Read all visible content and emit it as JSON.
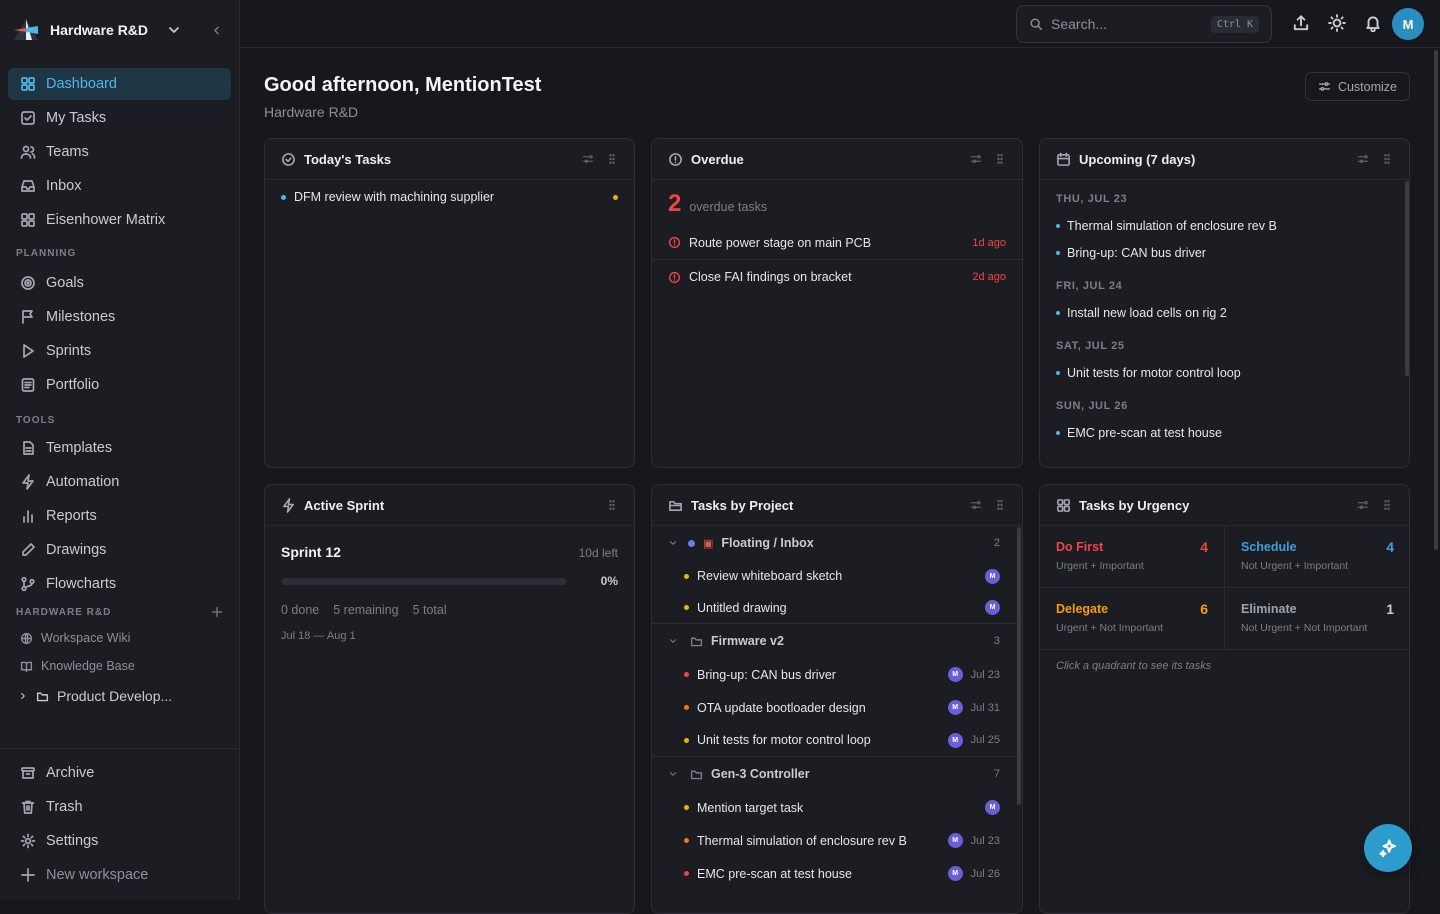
{
  "workspace": {
    "name": "Hardware R&D"
  },
  "nav": {
    "items": [
      {
        "label": "Dashboard",
        "icon": "dashboard-icon"
      },
      {
        "label": "My Tasks",
        "icon": "checkbox-icon"
      },
      {
        "label": "Teams",
        "icon": "users-icon"
      },
      {
        "label": "Inbox",
        "icon": "inbox-icon"
      },
      {
        "label": "Eisenhower Matrix",
        "icon": "grid-icon"
      }
    ]
  },
  "planning": {
    "heading": "PLANNING",
    "items": [
      {
        "label": "Goals"
      },
      {
        "label": "Milestones"
      },
      {
        "label": "Sprints"
      },
      {
        "label": "Portfolio"
      }
    ]
  },
  "tools": {
    "heading": "TOOLS",
    "items": [
      {
        "label": "Templates"
      },
      {
        "label": "Automation"
      },
      {
        "label": "Reports"
      },
      {
        "label": "Drawings"
      },
      {
        "label": "Flowcharts"
      }
    ]
  },
  "hwsection": {
    "heading": "HARDWARE R&D",
    "items": [
      {
        "label": "Workspace Wiki"
      },
      {
        "label": "Knowledge Base"
      },
      {
        "label": "Product Develop..."
      }
    ]
  },
  "bottom": {
    "items": [
      {
        "label": "Archive"
      },
      {
        "label": "Trash"
      },
      {
        "label": "Settings"
      },
      {
        "label": "New workspace"
      }
    ]
  },
  "search": {
    "placeholder": "Search...",
    "shortcut": "Ctrl K"
  },
  "user": {
    "initial": "M"
  },
  "page": {
    "greeting": "Good afternoon, MentionTest",
    "subtitle": "Hardware R&D",
    "customize": "Customize"
  },
  "today": {
    "title": "Today's Tasks",
    "tasks": [
      {
        "label": "DFM review with machining supplier"
      }
    ]
  },
  "overdue": {
    "title": "Overdue",
    "count": "2",
    "count_label": "overdue tasks",
    "tasks": [
      {
        "label": "Route power stage on main PCB",
        "ago": "1d ago"
      },
      {
        "label": "Close FAI findings on bracket",
        "ago": "2d ago"
      }
    ]
  },
  "upcoming": {
    "title": "Upcoming (7 days)",
    "groups": [
      {
        "day": "THU, JUL 23",
        "tasks": [
          "Thermal simulation of enclosure rev B",
          "Bring-up: CAN bus driver"
        ]
      },
      {
        "day": "FRI, JUL 24",
        "tasks": [
          "Install new load cells on rig 2"
        ]
      },
      {
        "day": "SAT, JUL 25",
        "tasks": [
          "Unit tests for motor control loop"
        ]
      },
      {
        "day": "SUN, JUL 26",
        "tasks": [
          "EMC pre-scan at test house"
        ]
      }
    ]
  },
  "sprint": {
    "title": "Active Sprint",
    "name": "Sprint 12",
    "left": "10d left",
    "percent": "0%",
    "progress": 0,
    "done": "0 done",
    "remaining": "5 remaining",
    "total": "5 total",
    "range": "Jul 18 — Aug 1"
  },
  "projects": {
    "title": "Tasks by Project",
    "groups": [
      {
        "name": "Floating / Inbox",
        "count": "2",
        "tasks": [
          {
            "label": "Review whiteboard sketch",
            "date": ""
          },
          {
            "label": "Untitled drawing",
            "date": ""
          }
        ]
      },
      {
        "name": "Firmware v2",
        "count": "3",
        "tasks": [
          {
            "label": "Bring-up: CAN bus driver",
            "date": "Jul 23"
          },
          {
            "label": "OTA update bootloader design",
            "date": "Jul 31"
          },
          {
            "label": "Unit tests for motor control loop",
            "date": "Jul 25"
          }
        ]
      },
      {
        "name": "Gen-3 Controller",
        "count": "7",
        "tasks": [
          {
            "label": "Mention target task",
            "date": ""
          },
          {
            "label": "Thermal simulation of enclosure rev B",
            "date": "Jul 23"
          },
          {
            "label": "EMC pre-scan at test house",
            "date": "Jul 26"
          }
        ]
      }
    ]
  },
  "urgency": {
    "title": "Tasks by Urgency",
    "quadrants": [
      {
        "title": "Do First",
        "sub": "Urgent + Important",
        "count": "4",
        "color": "#ef4444"
      },
      {
        "title": "Schedule",
        "sub": "Not Urgent + Important",
        "count": "4",
        "color": "#3b9fdc"
      },
      {
        "title": "Delegate",
        "sub": "Urgent + Not Important",
        "count": "6",
        "color": "#f59e0b"
      },
      {
        "title": "Eliminate",
        "sub": "Not Urgent + Not Important",
        "count": "1",
        "color": "#9ca3af"
      }
    ],
    "hint": "Click a quadrant to see its tasks"
  },
  "colors": {
    "accent": "#4fb6e6",
    "overdue": "#ef4444",
    "priority_high": "#ef4444",
    "priority_med": "#f97316",
    "priority_low": "#eab308",
    "info": "#3b9fdc"
  }
}
